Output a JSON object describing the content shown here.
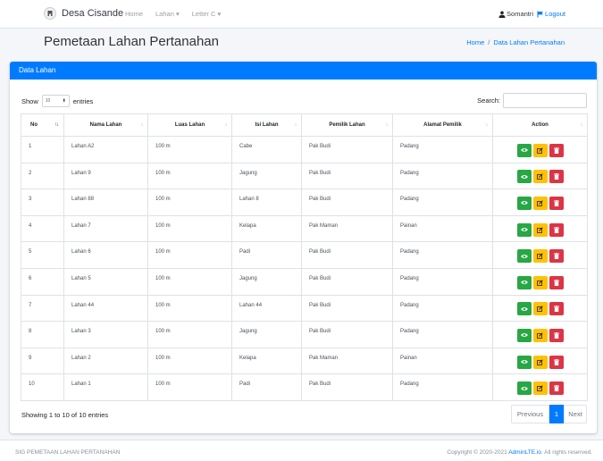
{
  "nav": {
    "brand": "Desa Cisande",
    "links": [
      "Home",
      "Lahan ▾",
      "Letter C ▾"
    ],
    "user": "Somantri",
    "logout": "Logout"
  },
  "header": {
    "title": "Pemetaan Lahan Pertanahan",
    "breadcrumb": [
      "Home",
      "/",
      "Data Lahan Pertanahan"
    ]
  },
  "card": {
    "title": "Data Lahan",
    "show_label": "Show",
    "length_value": "10",
    "entries_label": "entries",
    "search_label": "Search:"
  },
  "table": {
    "columns": [
      "No",
      "Nama Lahan",
      "Luas Lahan",
      "Isi Lahan",
      "Pemilik Lahan",
      "Alamat Pemilik",
      "Action"
    ],
    "rows": [
      [
        "1",
        "Lahan A2",
        "100 m",
        "Cabe",
        "Pak Budi",
        "Padang"
      ],
      [
        "2",
        "Lahan 9",
        "100 m",
        "Jagung",
        "Pak Budi",
        "Padang"
      ],
      [
        "3",
        "Lahan 88",
        "100 m",
        "Lahan 8",
        "Pak Budi",
        "Padang"
      ],
      [
        "4",
        "Lahan 7",
        "100 m",
        "Kelapa",
        "Pak Maman",
        "Painan"
      ],
      [
        "5",
        "Lahan 6",
        "100 m",
        "Padi",
        "Pak Budi",
        "Padang"
      ],
      [
        "6",
        "Lahan 5",
        "100 m",
        "Jagung",
        "Pak Budi",
        "Padang"
      ],
      [
        "7",
        "Lahan 44",
        "100 m",
        "Lahan 44",
        "Pak Budi",
        "Padang"
      ],
      [
        "8",
        "Lahan 3",
        "100 m",
        "Jagung",
        "Pak Budi",
        "Padang"
      ],
      [
        "9",
        "Lahan 2",
        "100 m",
        "Kelapa",
        "Pak Maman",
        "Painan"
      ],
      [
        "10",
        "Lahan 1",
        "100 m",
        "Padi",
        "Pak Budi",
        "Padang"
      ]
    ],
    "action_icons": [
      "eye-icon",
      "edit-icon",
      "trash-icon"
    ]
  },
  "pagination": {
    "info": "Showing 1 to 10 of 10 entries",
    "previous": "Previous",
    "current": "1",
    "next": "Next"
  },
  "footer": {
    "left": "SIG PEMETAAN LAHAN PERTANAHAN",
    "right_prefix": "Copyright © 2020-2021 ",
    "right_link": "AdminLTE.io",
    "right_suffix": ". All rights reserved."
  },
  "colors": {
    "primary": "#007bff",
    "view": "#28a745",
    "edit": "#ffc107",
    "delete": "#dc3545"
  }
}
